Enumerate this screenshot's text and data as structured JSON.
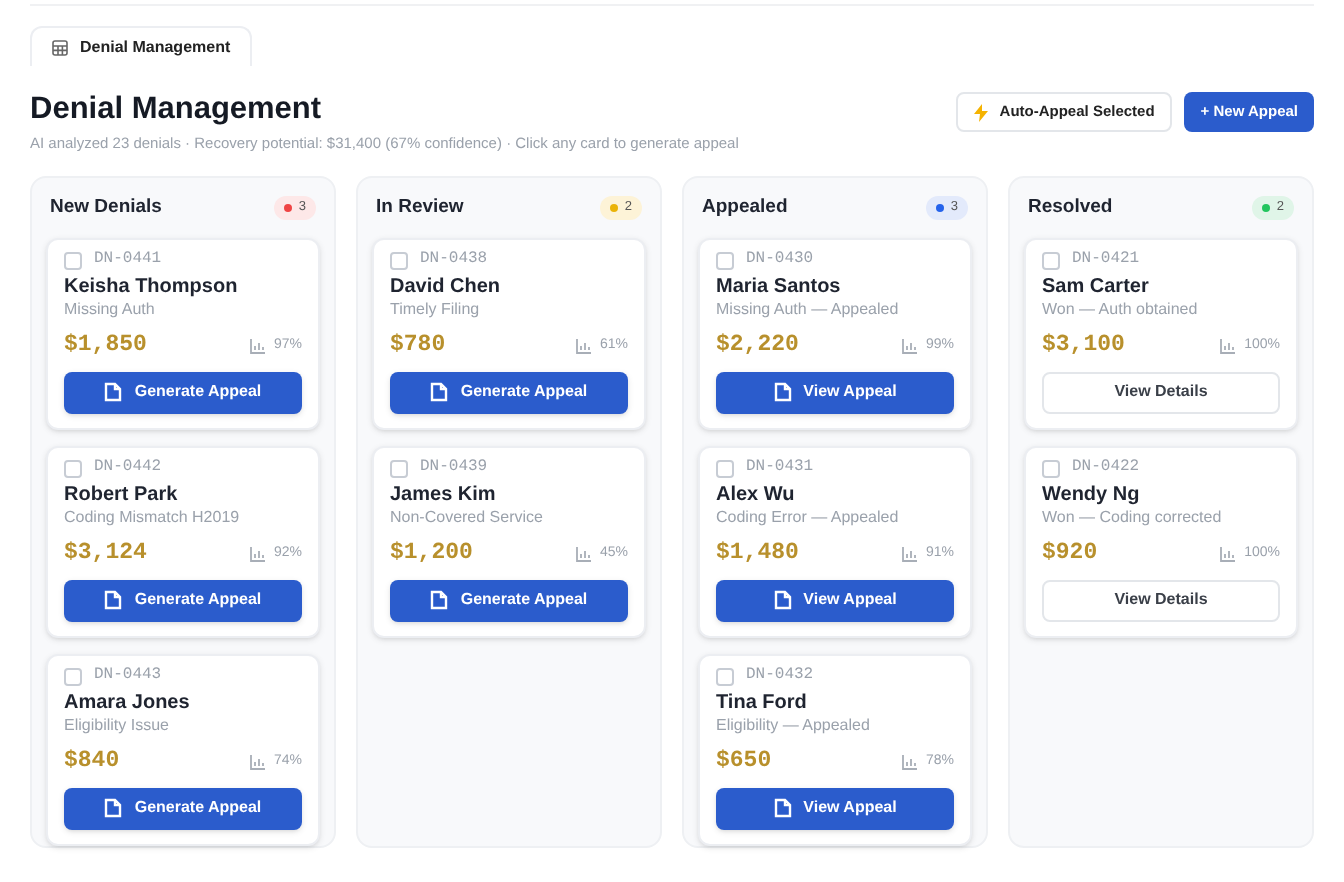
{
  "tab": {
    "label": "Denial Management",
    "selected": true
  },
  "header": {
    "title": "Denial Management",
    "subtitle": "AI analyzed 23 denials · Recovery potential: $31,400 (67% confidence) · Click any card to generate appeal"
  },
  "actions": [
    {
      "kind": "outline",
      "label": "Auto-Appeal Selected"
    },
    {
      "kind": "primary",
      "label": "+ New Appeal"
    }
  ],
  "columns": [
    {
      "title": "New Denials",
      "count": "3",
      "color": "#ef4444",
      "cards": [
        {
          "id": "DN-0441",
          "checked": false,
          "name": "Keisha Thompson",
          "reason": "Missing Auth",
          "amount": "$1,850",
          "confidence": "97%",
          "button": {
            "kind": "primary",
            "label": "Generate Appeal"
          }
        },
        {
          "id": "DN-0442",
          "checked": false,
          "name": "Robert Park",
          "reason": "Coding Mismatch H2019",
          "amount": "$3,124",
          "confidence": "92%",
          "button": {
            "kind": "primary",
            "label": "Generate Appeal"
          }
        },
        {
          "id": "DN-0443",
          "checked": false,
          "name": "Amara Jones",
          "reason": "Eligibility Issue",
          "amount": "$840",
          "confidence": "74%",
          "button": {
            "kind": "primary",
            "label": "Generate Appeal"
          }
        }
      ]
    },
    {
      "title": "In Review",
      "count": "2",
      "color": "#eab308",
      "cards": [
        {
          "id": "DN-0438",
          "checked": false,
          "name": "David Chen",
          "reason": "Timely Filing",
          "amount": "$780",
          "confidence": "61%",
          "button": {
            "kind": "primary",
            "label": "Generate Appeal"
          }
        },
        {
          "id": "DN-0439",
          "checked": false,
          "name": "James Kim",
          "reason": "Non-Covered Service",
          "amount": "$1,200",
          "confidence": "45%",
          "button": {
            "kind": "primary",
            "label": "Generate Appeal"
          }
        }
      ]
    },
    {
      "title": "Appealed",
      "count": "3",
      "color": "#2563eb",
      "cards": [
        {
          "id": "DN-0430",
          "checked": false,
          "name": "Maria Santos",
          "reason": "Missing Auth — Appealed",
          "amount": "$2,220",
          "confidence": "99%",
          "button": {
            "kind": "primary",
            "label": "View Appeal"
          }
        },
        {
          "id": "DN-0431",
          "checked": false,
          "name": "Alex Wu",
          "reason": "Coding Error — Appealed",
          "amount": "$1,480",
          "confidence": "91%",
          "button": {
            "kind": "primary",
            "label": "View Appeal"
          }
        },
        {
          "id": "DN-0432",
          "checked": false,
          "name": "Tina Ford",
          "reason": "Eligibility — Appealed",
          "amount": "$650",
          "confidence": "78%",
          "button": {
            "kind": "primary",
            "label": "View Appeal"
          }
        }
      ]
    },
    {
      "title": "Resolved",
      "count": "2",
      "color": "#22c55e",
      "cards": [
        {
          "id": "DN-0421",
          "checked": false,
          "name": "Sam Carter",
          "reason": "Won — Auth obtained",
          "amount": "$3,100",
          "confidence": "100%",
          "button": {
            "kind": "outline",
            "label": "View Details"
          }
        },
        {
          "id": "DN-0422",
          "checked": false,
          "name": "Wendy Ng",
          "reason": "Won — Coding corrected",
          "amount": "$920",
          "confidence": "100%",
          "button": {
            "kind": "outline",
            "label": "View Details"
          }
        }
      ]
    }
  ]
}
